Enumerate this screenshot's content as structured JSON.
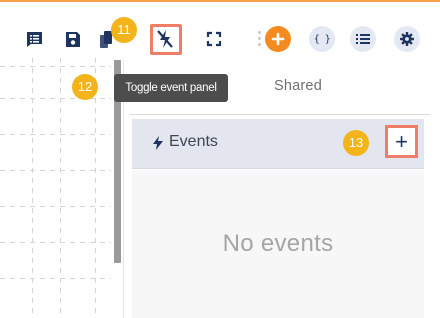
{
  "toolbar": {
    "buttons": [
      "list-view",
      "save",
      "copy",
      "toggle-event-panel",
      "fullscreen",
      "add",
      "code",
      "menu",
      "settings"
    ],
    "highlight_color": "#ee7e68",
    "add_button_color": "#f58a1f",
    "icon_color": "#1e3561"
  },
  "tooltip": {
    "text": "Toggle event panel"
  },
  "tabs": {
    "shared_label": "Shared"
  },
  "events": {
    "title": "Events",
    "add_symbol": "+",
    "empty_text": "No events"
  },
  "callouts": [
    {
      "number": "11",
      "target": "toggle-event-panel"
    },
    {
      "number": "12",
      "target": "tooltip"
    },
    {
      "number": "13",
      "target": "add-event-button"
    }
  ],
  "colors": {
    "accent": "#f58a1f",
    "callout": "#f3b31a",
    "events_bar": "#e3e6ef",
    "tooltip_bg": "#4d4d4d"
  }
}
